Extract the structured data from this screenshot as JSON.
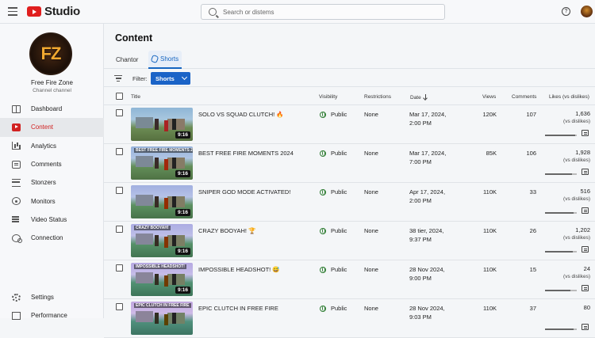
{
  "header": {
    "app_name": "Studio",
    "search_placeholder": "Search or distems",
    "help_symbol": "?"
  },
  "channel": {
    "initials": "FZ",
    "name": "Free Fire Zone",
    "subtitle": "Channel channel"
  },
  "sidebar": {
    "items": [
      {
        "label": "Dashboard",
        "icon": "dashboard-icon"
      },
      {
        "label": "Content",
        "icon": "content-icon"
      },
      {
        "label": "Analytics",
        "icon": "analytics-icon"
      },
      {
        "label": "Comments",
        "icon": "comments-icon"
      },
      {
        "label": "Stonzers",
        "icon": "list-icon"
      },
      {
        "label": "Monitors",
        "icon": "monitor-icon"
      },
      {
        "label": "Video Status",
        "icon": "video-status-icon"
      },
      {
        "label": "Connection",
        "icon": "connection-icon"
      }
    ],
    "bottom": [
      {
        "label": "Settings",
        "icon": "gear-icon"
      },
      {
        "label": "Performance",
        "icon": "performance-icon"
      }
    ]
  },
  "page": {
    "title": "Content",
    "tabs": [
      "Chantor",
      "Shorts"
    ],
    "filter_label": "Filter:",
    "filter_value": "Shorts"
  },
  "table": {
    "headers": {
      "title": "Title",
      "visibility": "Visibility",
      "restrictions": "Restrictions",
      "date": "Date",
      "views": "Views",
      "comments": "Comments",
      "likes": "Likes (vs dislikes)"
    },
    "rows": [
      {
        "thumb_caption": "",
        "duration": "9:16",
        "title": "SOLO VS SQUAD CLUTCH! 🔥",
        "visibility": "Public",
        "restrictions": "None",
        "date_line1": "Mar 17, 2024,",
        "date_line2": "2:00 PM",
        "views": "120K",
        "comments": "107",
        "likes": "1,636",
        "likes_sub": "(vs dislikes)",
        "like_ratio": 0.95
      },
      {
        "thumb_caption": "BEST FREE FIRE MOMENTS 2024",
        "duration": "9:16",
        "title": "BEST FREE FIRE MOMENTS 2024",
        "visibility": "Public",
        "restrictions": "None",
        "date_line1": "Mar 17, 2024,",
        "date_line2": "7:00 PM",
        "views": "85K",
        "comments": "106",
        "likes": "1,928",
        "likes_sub": "(vs dislikes)",
        "like_ratio": 0.85
      },
      {
        "thumb_caption": "",
        "duration": "9:16",
        "title": "SNIPER GOD MODE ACTIVATED!",
        "visibility": "Public",
        "restrictions": "None",
        "date_line1": "Apr 17, 2024,",
        "date_line2": "2:00 PM",
        "views": "110K",
        "comments": "33",
        "likes": "516",
        "likes_sub": "(vs dislikes)",
        "like_ratio": 0.9
      },
      {
        "thumb_caption": "CRAZY BOOYAH!",
        "duration": "9:16",
        "title": "CRAZY BOOYAH! 🏆",
        "visibility": "Public",
        "restrictions": "None",
        "date_line1": "38 tier, 2024,",
        "date_line2": "9:37 PM",
        "views": "110K",
        "comments": "26",
        "likes": "1,202",
        "likes_sub": "(vs dislikes)",
        "like_ratio": 0.88
      },
      {
        "thumb_caption": "IMPOSSIBLE HEADSHOT!",
        "duration": "9:16",
        "title": "IMPOSSIBLE HEADSHOT! 😅",
        "visibility": "Public",
        "restrictions": "None",
        "date_line1": "28 Nov 2024,",
        "date_line2": "9:00 PM",
        "views": "110K",
        "comments": "15",
        "likes": "24",
        "likes_sub": "(vs dislikes)",
        "like_ratio": 0.8
      },
      {
        "thumb_caption": "EPIC CLUTCH IN FREE FIRE",
        "duration": "",
        "title": "EPIC CLUTCH IN FREE FIRE",
        "visibility": "Public",
        "restrictions": "None",
        "date_line1": "28 Nov 2024,",
        "date_line2": "9:03 PM",
        "views": "110K",
        "comments": "37",
        "likes": "80",
        "likes_sub": "",
        "like_ratio": 0.9
      }
    ]
  },
  "colors": {
    "accent": "#1a63c7",
    "brand_red": "#e01e1e",
    "public_green": "#2e7d32"
  }
}
